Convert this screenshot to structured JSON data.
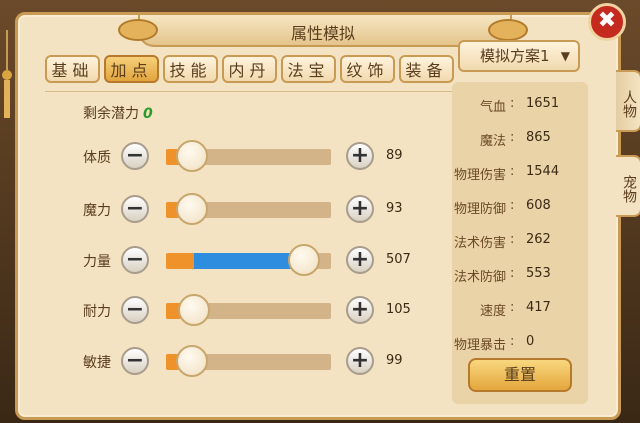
{
  "window": {
    "title": "属性模拟",
    "close_icon": "✖"
  },
  "tabs": [
    {
      "label": "基础",
      "active": false
    },
    {
      "label": "加点",
      "active": true
    },
    {
      "label": "技能",
      "active": false
    },
    {
      "label": "内丹",
      "active": false
    },
    {
      "label": "法宝",
      "active": false
    },
    {
      "label": "纹饰",
      "active": false
    },
    {
      "label": "装备",
      "active": false
    }
  ],
  "potential": {
    "label": "剩余潜力",
    "value": "0"
  },
  "attributes": [
    {
      "label": "体质",
      "value": "89"
    },
    {
      "label": "魔力",
      "value": "93"
    },
    {
      "label": "力量",
      "value": "507"
    },
    {
      "label": "耐力",
      "value": "105"
    },
    {
      "label": "敏捷",
      "value": "99"
    }
  ],
  "scheme": {
    "label": "模拟方案1",
    "icon": "chevron-down-icon"
  },
  "stats": [
    {
      "name": "气血",
      "value": "1651"
    },
    {
      "name": "魔法",
      "value": "865"
    },
    {
      "name": "物理伤害",
      "value": "1544"
    },
    {
      "name": "物理防御",
      "value": "608"
    },
    {
      "name": "法术伤害",
      "value": "262"
    },
    {
      "name": "法术防御",
      "value": "553"
    },
    {
      "name": "速度",
      "value": "417"
    },
    {
      "name": "物理暴击",
      "value": "0"
    }
  ],
  "stat_separator": ":",
  "reset_label": "重置",
  "side_tabs": [
    {
      "label": "人物",
      "active": false
    },
    {
      "label": "宠物",
      "active": true
    }
  ],
  "colors": {
    "accent_orange": "#f0922a",
    "accent_blue": "#2f8de0",
    "potential_green": "#2a9b2a",
    "close_red": "#c52a1f"
  }
}
